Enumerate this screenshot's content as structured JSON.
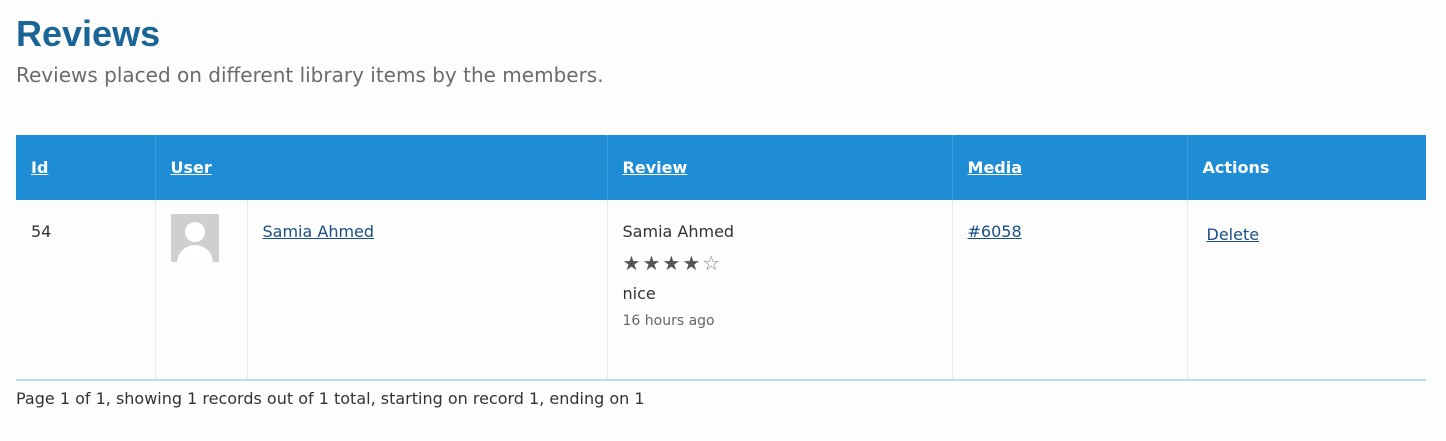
{
  "header": {
    "title": "Reviews",
    "subtitle": "Reviews placed on different library items by the members."
  },
  "table": {
    "columns": {
      "id": "Id",
      "user": "User",
      "review": "Review",
      "media": "Media",
      "actions": "Actions"
    },
    "rows": [
      {
        "id": "54",
        "user_name": "Samia Ahmed",
        "review_author": "Samia Ahmed",
        "rating": 4,
        "rating_max": 5,
        "review_text": "nice",
        "review_time": "16 hours ago",
        "media": "#6058",
        "action_delete": "Delete"
      }
    ]
  },
  "pagination": {
    "summary": "Page 1 of 1, showing 1 records out of 1 total, starting on record 1, ending on 1"
  },
  "colors": {
    "header_bg": "#1e8dd6",
    "title": "#1a6496",
    "link": "#1a4f86"
  },
  "icons": {
    "avatar": "user-avatar-placeholder",
    "star_full": "star-filled-icon",
    "star_empty": "star-outline-icon"
  }
}
